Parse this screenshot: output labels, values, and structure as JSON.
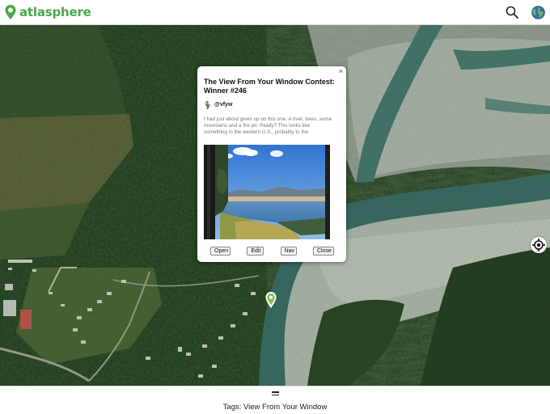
{
  "header": {
    "logo_text": "atlasphere",
    "search_icon": "search-icon",
    "globe_icon": "globe-icon",
    "brand_color": "#4aa84a"
  },
  "map": {
    "locate_icon": "crosshair-icon",
    "pin_icon": "map-pin-icon"
  },
  "popup": {
    "close_label": "×",
    "title": "The View From Your Window Contest: Winner #246",
    "user": "@vfyw",
    "description": "I had just about given up on this one. A river, trees, some mountains and a fire pit. Really? This looks like something in the western U.S., probably to the",
    "buttons": {
      "open": "Open",
      "edit": "Edit",
      "nav": "Nav",
      "close": "Close"
    }
  },
  "footer": {
    "tags": "Tags: View From Your Window"
  }
}
